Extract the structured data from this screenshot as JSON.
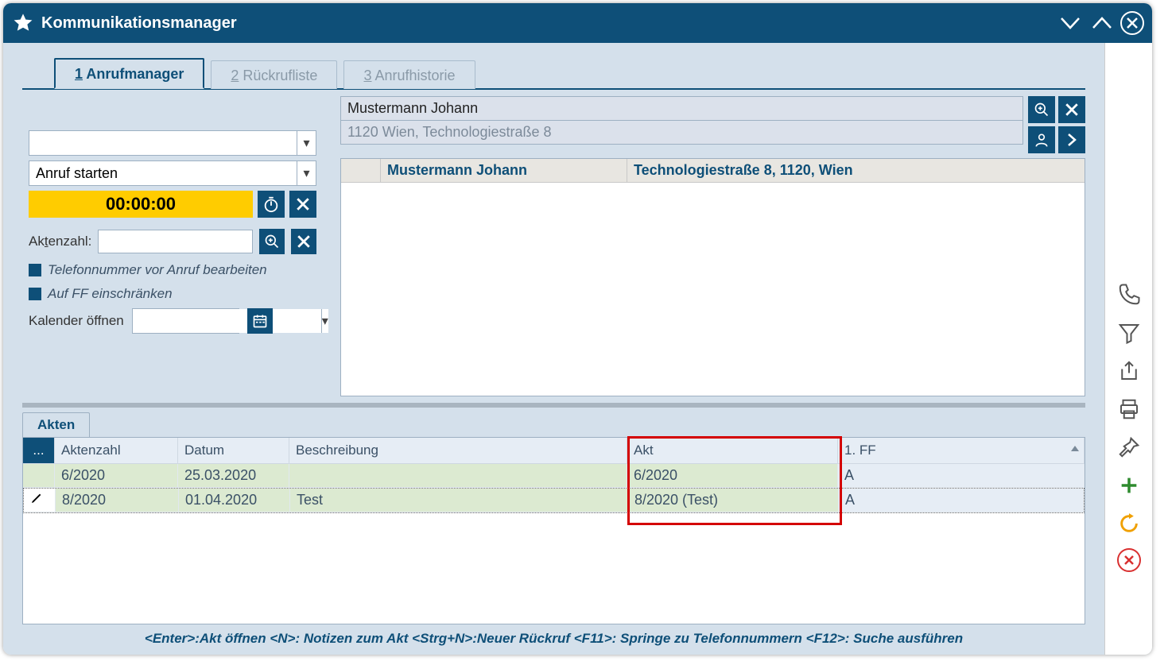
{
  "title": "Kommunikationsmanager",
  "tabs": [
    {
      "num": "1",
      "label": "Anrufmanager"
    },
    {
      "num": "2",
      "label": "Rückrufliste"
    },
    {
      "num": "3",
      "label": "Anrufhistorie"
    }
  ],
  "left": {
    "combo1": "",
    "combo2": "Anruf starten",
    "timer": "00:00:00",
    "aktenzahl_label": "Aktenzahl:",
    "aktenzahl_value": "",
    "chk1": "Telefonnummer vor Anruf bearbeiten",
    "chk2": "Auf FF einschränken",
    "kalender_label": "Kalender öffnen",
    "kalender_value": ""
  },
  "contact": {
    "name": "Mustermann Johann",
    "addr": "1120 Wien, Technologiestraße 8",
    "grid_name": "Mustermann Johann",
    "grid_addr": "Technologiestraße 8, 1120, Wien"
  },
  "akten": {
    "tab_label": "Akten",
    "menu_btn": "...",
    "headers": {
      "aktenzahl": "Aktenzahl",
      "datum": "Datum",
      "beschreibung": "Beschreibung",
      "akt": "Akt",
      "ff": "1. FF"
    },
    "rows": [
      {
        "edit": false,
        "aktenzahl": "6/2020",
        "datum": "25.03.2020",
        "beschreibung": "",
        "akt": "6/2020",
        "ff": "A"
      },
      {
        "edit": true,
        "aktenzahl": "8/2020",
        "datum": "01.04.2020",
        "beschreibung": "Test",
        "akt": "8/2020 (Test)",
        "ff": "A"
      }
    ]
  },
  "footer_hint": "<Enter>:Akt öffnen <N>: Notizen zum Akt <Strg+N>:Neuer Rückruf <F11>: Springe zu Telefonnummern <F12>: Suche ausführen"
}
